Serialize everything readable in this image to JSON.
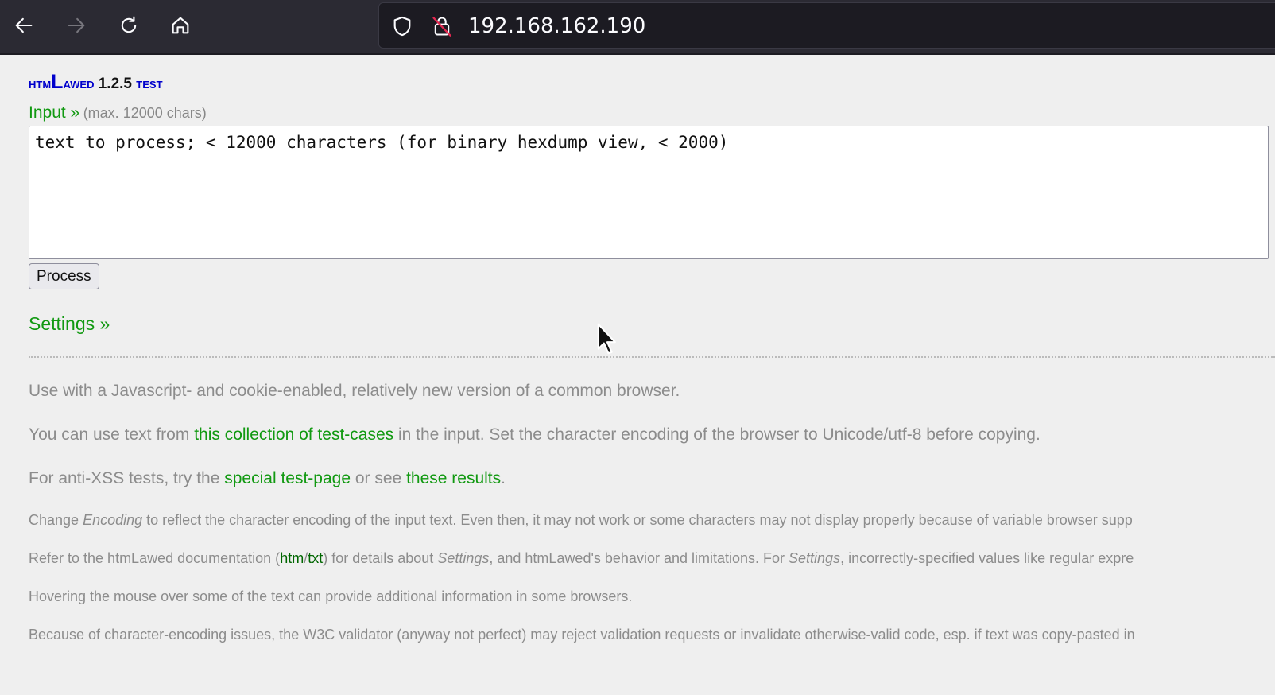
{
  "browser": {
    "url": "192.168.162.190"
  },
  "app": {
    "brand_prefix": "htm",
    "brand_big": "L",
    "brand_suffix": "awed",
    "version": "1.2.5",
    "test_label": "test"
  },
  "input": {
    "label": "Input »",
    "max_note": "(max. 12000 chars)",
    "placeholder": "text to process; < 12000 characters (for binary hexdump view, < 2000)"
  },
  "process_button": "Process",
  "settings_link": "Settings »",
  "info": {
    "p1": "Use with a Javascript- and cookie-enabled, relatively new version of a common browser.",
    "p2_pre": "You can use text from ",
    "p2_link": "this collection of test-cases",
    "p2_post": " in the input. Set the character encoding of the browser to Unicode/utf-8 before copying.",
    "p3_pre": "For anti-XSS tests, try the ",
    "p3_link1": "special test-page",
    "p3_mid": " or see ",
    "p3_link2": "these results",
    "p3_post": ".",
    "p4_pre": "Change ",
    "p4_italic": "Encoding",
    "p4_post": " to reflect the character encoding of the input text. Even then, it may not work or some characters may not display properly because of variable browser supp",
    "p5_pre": "Refer to the htmLawed documentation (",
    "p5_link1": "htm",
    "p5_sep": "/",
    "p5_link2": "txt",
    "p5_mid": ") for details about ",
    "p5_italic1": "Settings",
    "p5_mid2": ", and htmLawed's behavior and limitations. For ",
    "p5_italic2": "Settings",
    "p5_post": ", incorrectly-specified values like regular expre",
    "p6": "Hovering the mouse over some of the text can provide additional information in some browsers.",
    "p7": "Because of character-encoding issues, the W3C validator (anyway not perfect) may reject validation requests or invalidate otherwise-valid code, esp. if text was copy-pasted in"
  }
}
